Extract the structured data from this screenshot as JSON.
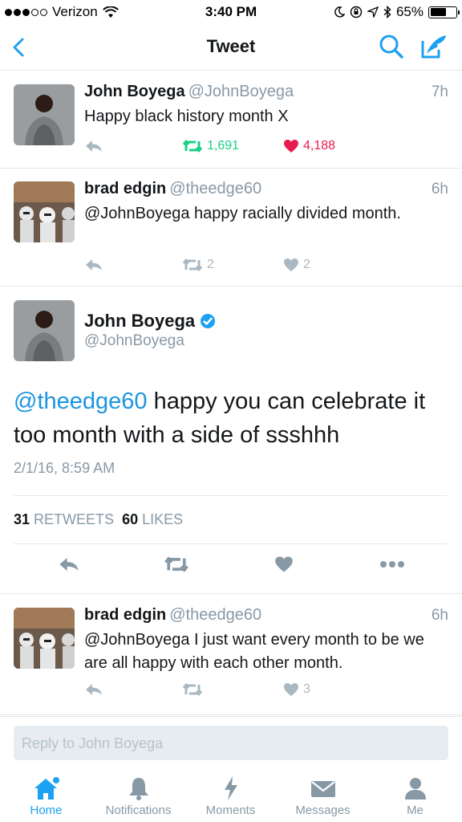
{
  "status_bar": {
    "carrier": "Verizon",
    "time": "3:40 PM",
    "battery": "65%",
    "battery_level": 0.65
  },
  "nav": {
    "title": "Tweet"
  },
  "tweets": [
    {
      "name": "John Boyega",
      "handle": "@JohnBoyega",
      "time": "7h",
      "text": "Happy black history month X",
      "retweets": "1,691",
      "likes": "4,188",
      "retweeted": true,
      "liked": true
    },
    {
      "name": "brad edgin",
      "handle": "@theedge60",
      "time": "6h",
      "text": "@JohnBoyega happy racially divided month.",
      "retweets": "2",
      "likes": "2"
    },
    {
      "name": "brad edgin",
      "handle": "@theedge60",
      "time": "6h",
      "text": "@JohnBoyega I just want every month to be we are all happy with each other month.",
      "retweets": "",
      "likes": "3"
    }
  ],
  "detail": {
    "name": "John Boyega",
    "handle": "@JohnBoyega",
    "mention": "@theedge60",
    "text": " happy you can celebrate it too month with a side of ssshhh",
    "date": "2/1/16, 8:59 AM",
    "retweet_count": "31",
    "retweet_label": "RETWEETS",
    "like_count": "60",
    "like_label": "LIKES"
  },
  "reply": {
    "placeholder": "Reply to John Boyega"
  },
  "tabs": [
    {
      "label": "Home",
      "icon": "home-icon",
      "active": true
    },
    {
      "label": "Notifications",
      "icon": "bell-icon"
    },
    {
      "label": "Moments",
      "icon": "lightning-icon"
    },
    {
      "label": "Messages",
      "icon": "envelope-icon"
    },
    {
      "label": "Me",
      "icon": "person-icon"
    }
  ],
  "colors": {
    "accent": "#1da1f2",
    "retweet_green": "#19cf86",
    "like_red": "#e81c4f",
    "muted": "#8899a6"
  }
}
